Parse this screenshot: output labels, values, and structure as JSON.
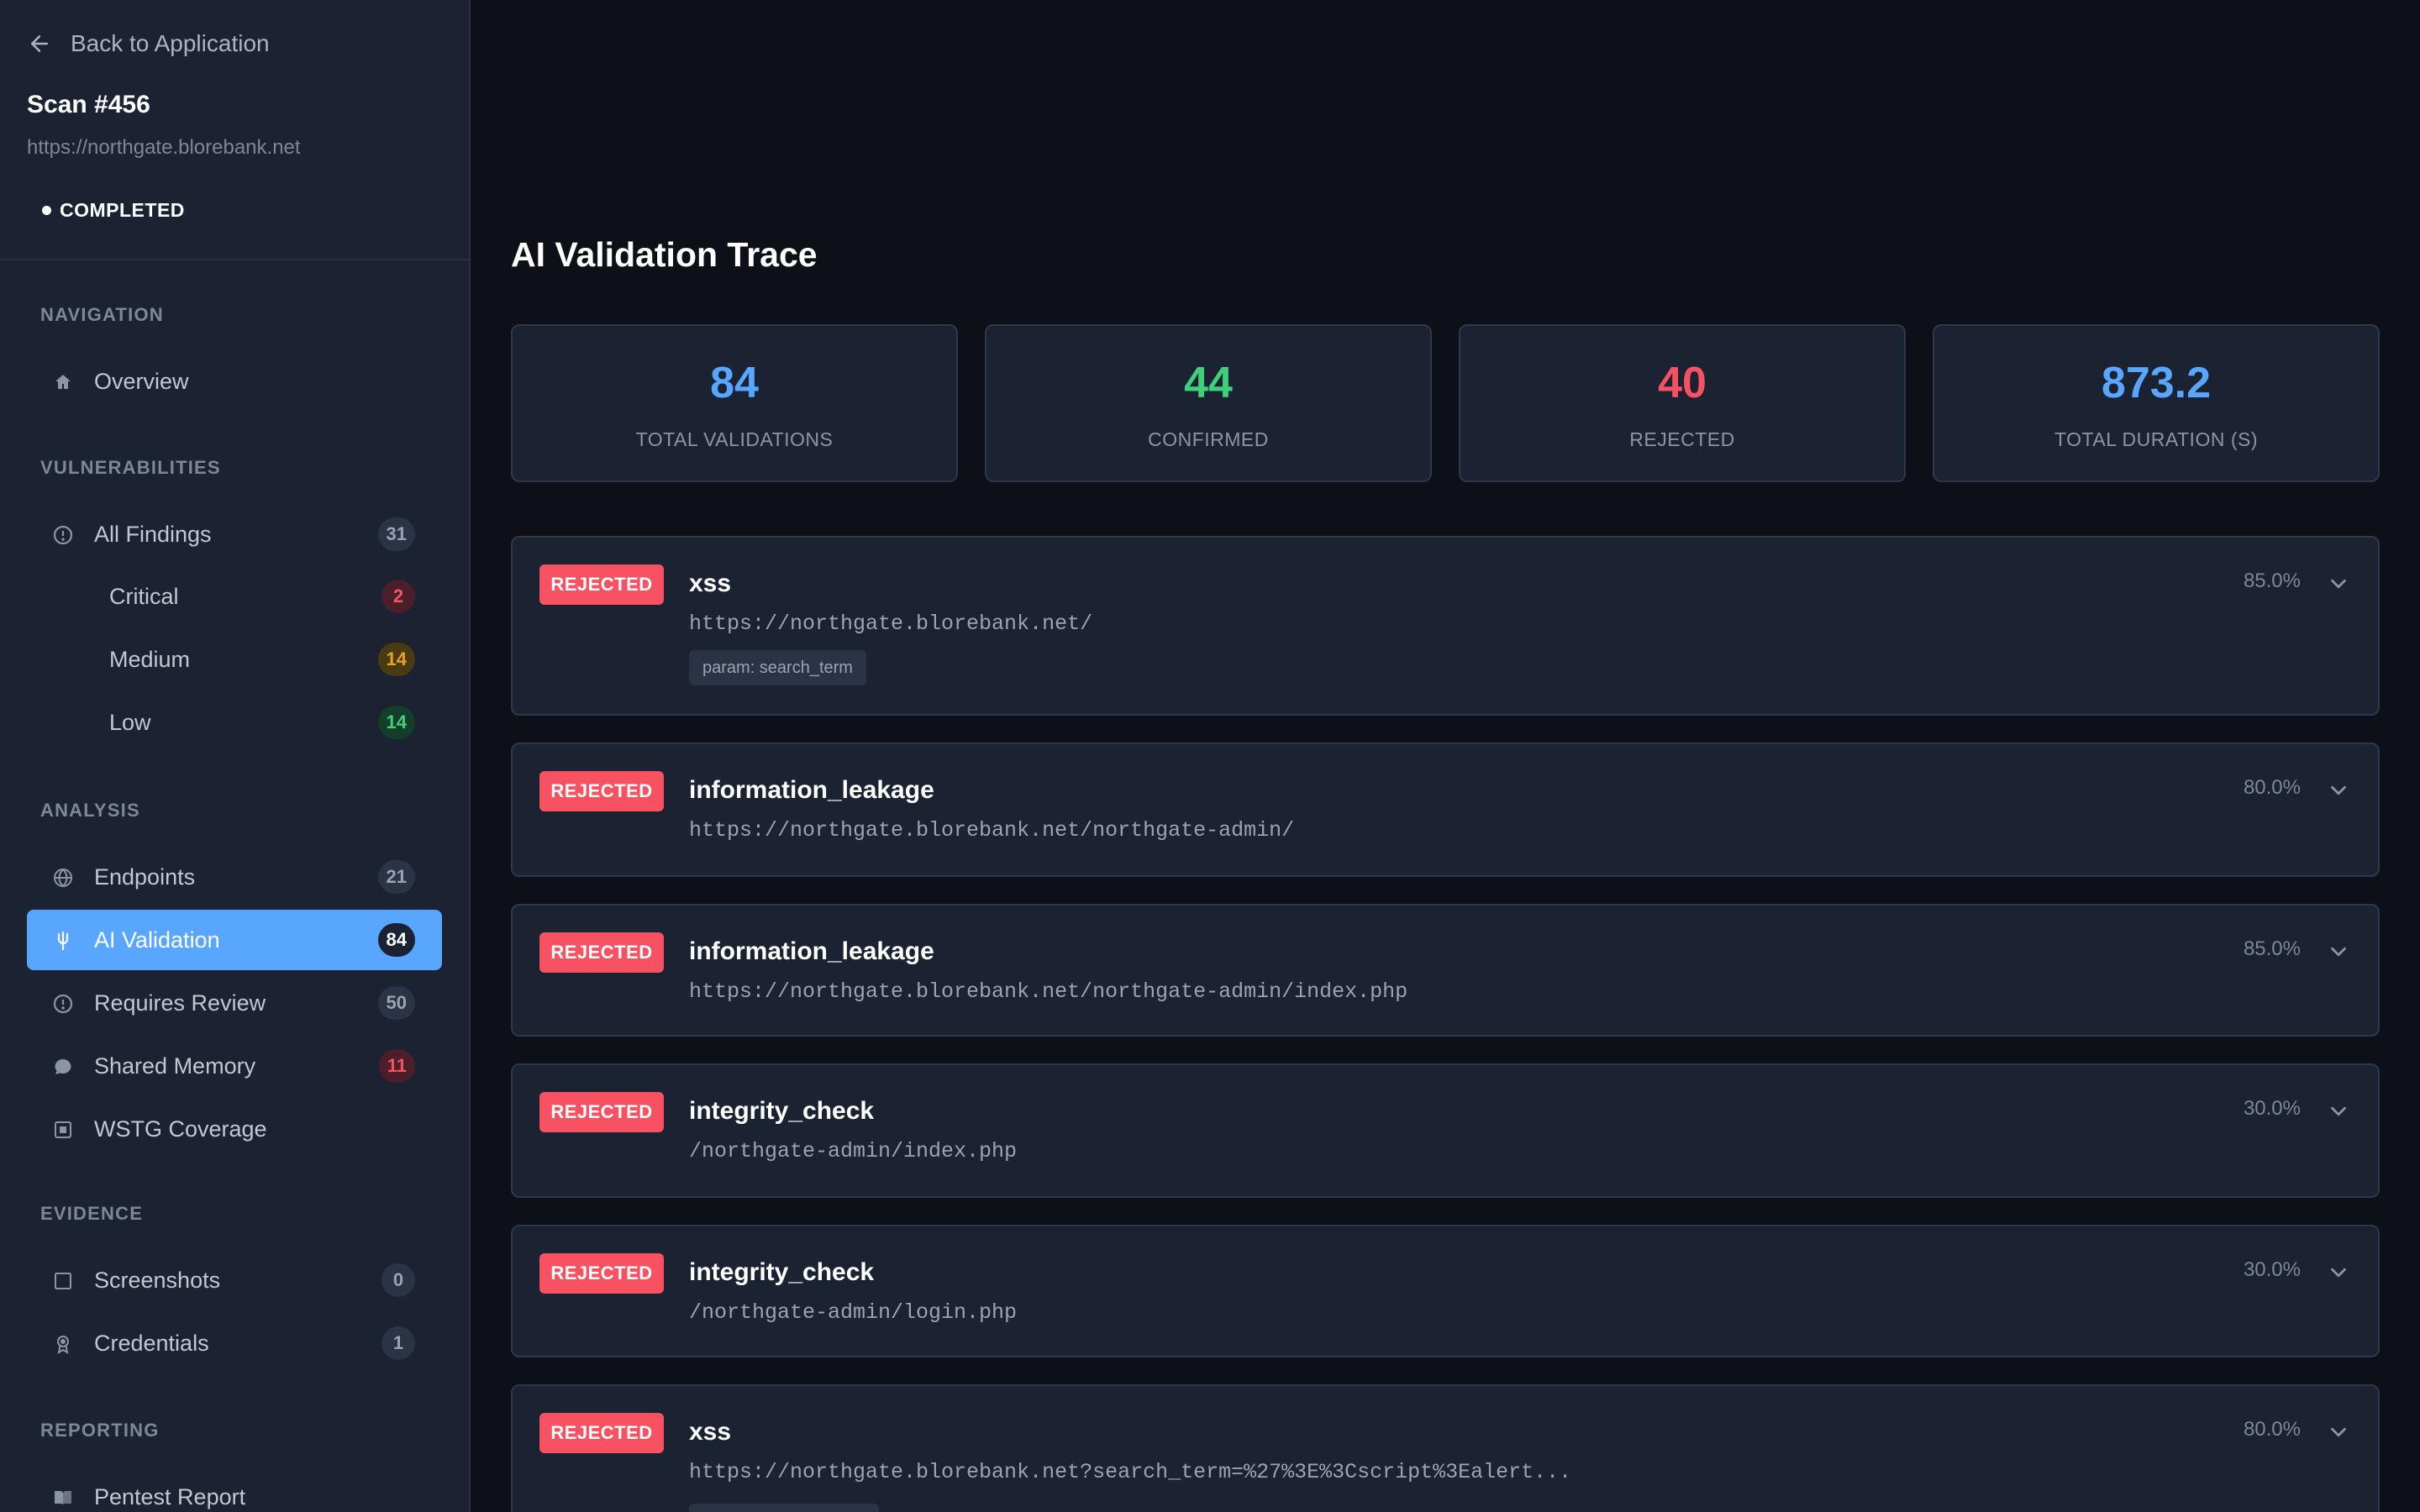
{
  "colors": {
    "accent": "#58a6ff",
    "confirmed": "#3fd07a",
    "rejected": "#f85162",
    "completed": "#3fd07a"
  },
  "sidebar": {
    "back_label": "Back to Application",
    "scan_title": "Scan #456",
    "scan_url": "https://northgate.blorebank.net",
    "status": "COMPLETED",
    "sections": {
      "navigation": "NAVIGATION",
      "vulnerabilities": "VULNERABILITIES",
      "analysis": "ANALYSIS",
      "evidence": "EVIDENCE",
      "reporting": "REPORTING"
    },
    "items": {
      "overview": {
        "label": "Overview",
        "icon": "home-icon"
      },
      "all_findings": {
        "label": "All Findings",
        "count": "31",
        "icon": "alert-circle-icon"
      },
      "critical": {
        "label": "Critical",
        "count": "2"
      },
      "medium": {
        "label": "Medium",
        "count": "14"
      },
      "low": {
        "label": "Low",
        "count": "14"
      },
      "endpoints": {
        "label": "Endpoints",
        "count": "21",
        "icon": "globe-icon"
      },
      "ai_validation": {
        "label": "AI Validation",
        "count": "84",
        "icon": "fork-icon",
        "active": true
      },
      "requires_review": {
        "label": "Requires Review",
        "count": "50",
        "icon": "alert-circle-icon"
      },
      "shared_memory": {
        "label": "Shared Memory",
        "count": "11",
        "icon": "chat-bubble-icon"
      },
      "wstg_coverage": {
        "label": "WSTG Coverage",
        "icon": "target-square-icon"
      },
      "screenshots": {
        "label": "Screenshots",
        "count": "0",
        "icon": "square-icon"
      },
      "credentials": {
        "label": "Credentials",
        "count": "1",
        "icon": "badge-icon"
      },
      "pentest_report": {
        "label": "Pentest Report",
        "icon": "book-icon"
      }
    }
  },
  "main": {
    "title": "AI Validation Trace",
    "stats": [
      {
        "value": "84",
        "label": "TOTAL VALIDATIONS",
        "color": "#58a6ff"
      },
      {
        "value": "44",
        "label": "CONFIRMED",
        "color": "#3fd07a"
      },
      {
        "value": "40",
        "label": "REJECTED",
        "color": "#f85162"
      },
      {
        "value": "873.2",
        "label": "TOTAL DURATION (S)",
        "color": "#58a6ff"
      }
    ],
    "validations": [
      {
        "verdict": "REJECTED",
        "type": "xss",
        "url": "https://northgate.blorebank.net/",
        "param": "param: search_term",
        "confidence": "85.0%"
      },
      {
        "verdict": "REJECTED",
        "type": "information_leakage",
        "url": "https://northgate.blorebank.net/northgate-admin/",
        "confidence": "80.0%"
      },
      {
        "verdict": "REJECTED",
        "type": "information_leakage",
        "url": "https://northgate.blorebank.net/northgate-admin/index.php",
        "confidence": "85.0%"
      },
      {
        "verdict": "REJECTED",
        "type": "integrity_check",
        "url": "/northgate-admin/index.php",
        "confidence": "30.0%"
      },
      {
        "verdict": "REJECTED",
        "type": "integrity_check",
        "url": "/northgate-admin/login.php",
        "confidence": "30.0%"
      },
      {
        "verdict": "REJECTED",
        "type": "xss",
        "url": "https://northgate.blorebank.net?search_term=%27%3E%3Cscript%3Ealert...",
        "confidence": "80.0%"
      }
    ]
  }
}
